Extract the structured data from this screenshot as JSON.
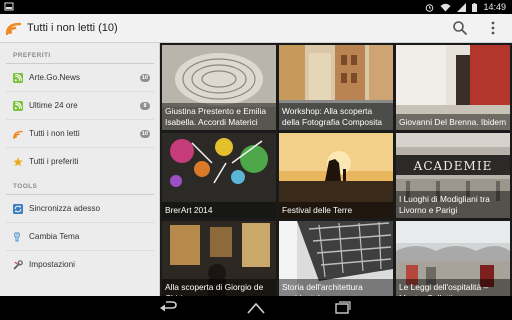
{
  "status_bar": {
    "time": "14:49",
    "icons": [
      "notification-icon",
      "alarm-icon",
      "wifi-icon",
      "signal-icon",
      "battery-icon"
    ]
  },
  "action_bar": {
    "title": "Tutti i non letti (10)",
    "icons": [
      "app-rss-icon",
      "search-icon",
      "overflow-menu-icon"
    ]
  },
  "drawer": {
    "sections": [
      {
        "header": "PREFERITI",
        "items": [
          {
            "label": "Arte.Go.News",
            "badge": "10",
            "icon": "rss-feed-icon"
          },
          {
            "label": "Ultime 24 ore",
            "badge": "8",
            "icon": "rss-feed-icon"
          },
          {
            "label": "Tutti i non letti",
            "badge": "10",
            "icon": "rss-unread-icon"
          },
          {
            "label": "Tutti i preferiti",
            "badge": "",
            "icon": "star-icon"
          }
        ]
      },
      {
        "header": "TOOLS",
        "items": [
          {
            "label": "Sincronizza adesso",
            "icon": "sync-icon"
          },
          {
            "label": "Cambia Tema",
            "icon": "brush-icon"
          },
          {
            "label": "Impostazioni",
            "icon": "wrench-icon"
          }
        ]
      }
    ]
  },
  "grid": {
    "tiles": [
      {
        "caption": "Giustina Prestento e Emilia Isabella. Accordi Materici"
      },
      {
        "caption": "Workshop: Alla scoperta della Fotografia Composita"
      },
      {
        "caption": "Giovanni Del Brenna. Ibidem"
      },
      {
        "caption": "BrerArt 2014"
      },
      {
        "caption": "Festival delle Terre"
      },
      {
        "caption": "I Luoghi di Modigliani tra Livorno e Parigi"
      },
      {
        "caption": "Alla scoperta di Giorgio de Chirico"
      },
      {
        "caption": "Storia dell'architettura occidentale"
      },
      {
        "caption": "Le Leggi dell'ospitalità – Mostra Collettiva"
      }
    ],
    "sign_text": "ACADEMIE"
  },
  "nav_bar": {
    "buttons": [
      "back-icon",
      "home-icon",
      "recents-icon"
    ]
  },
  "colors": {
    "accent": "#f08a24",
    "rss": "#7cc23c",
    "drawer_bg": "#ececec",
    "actionbar_bg": "#f2f2f2"
  }
}
